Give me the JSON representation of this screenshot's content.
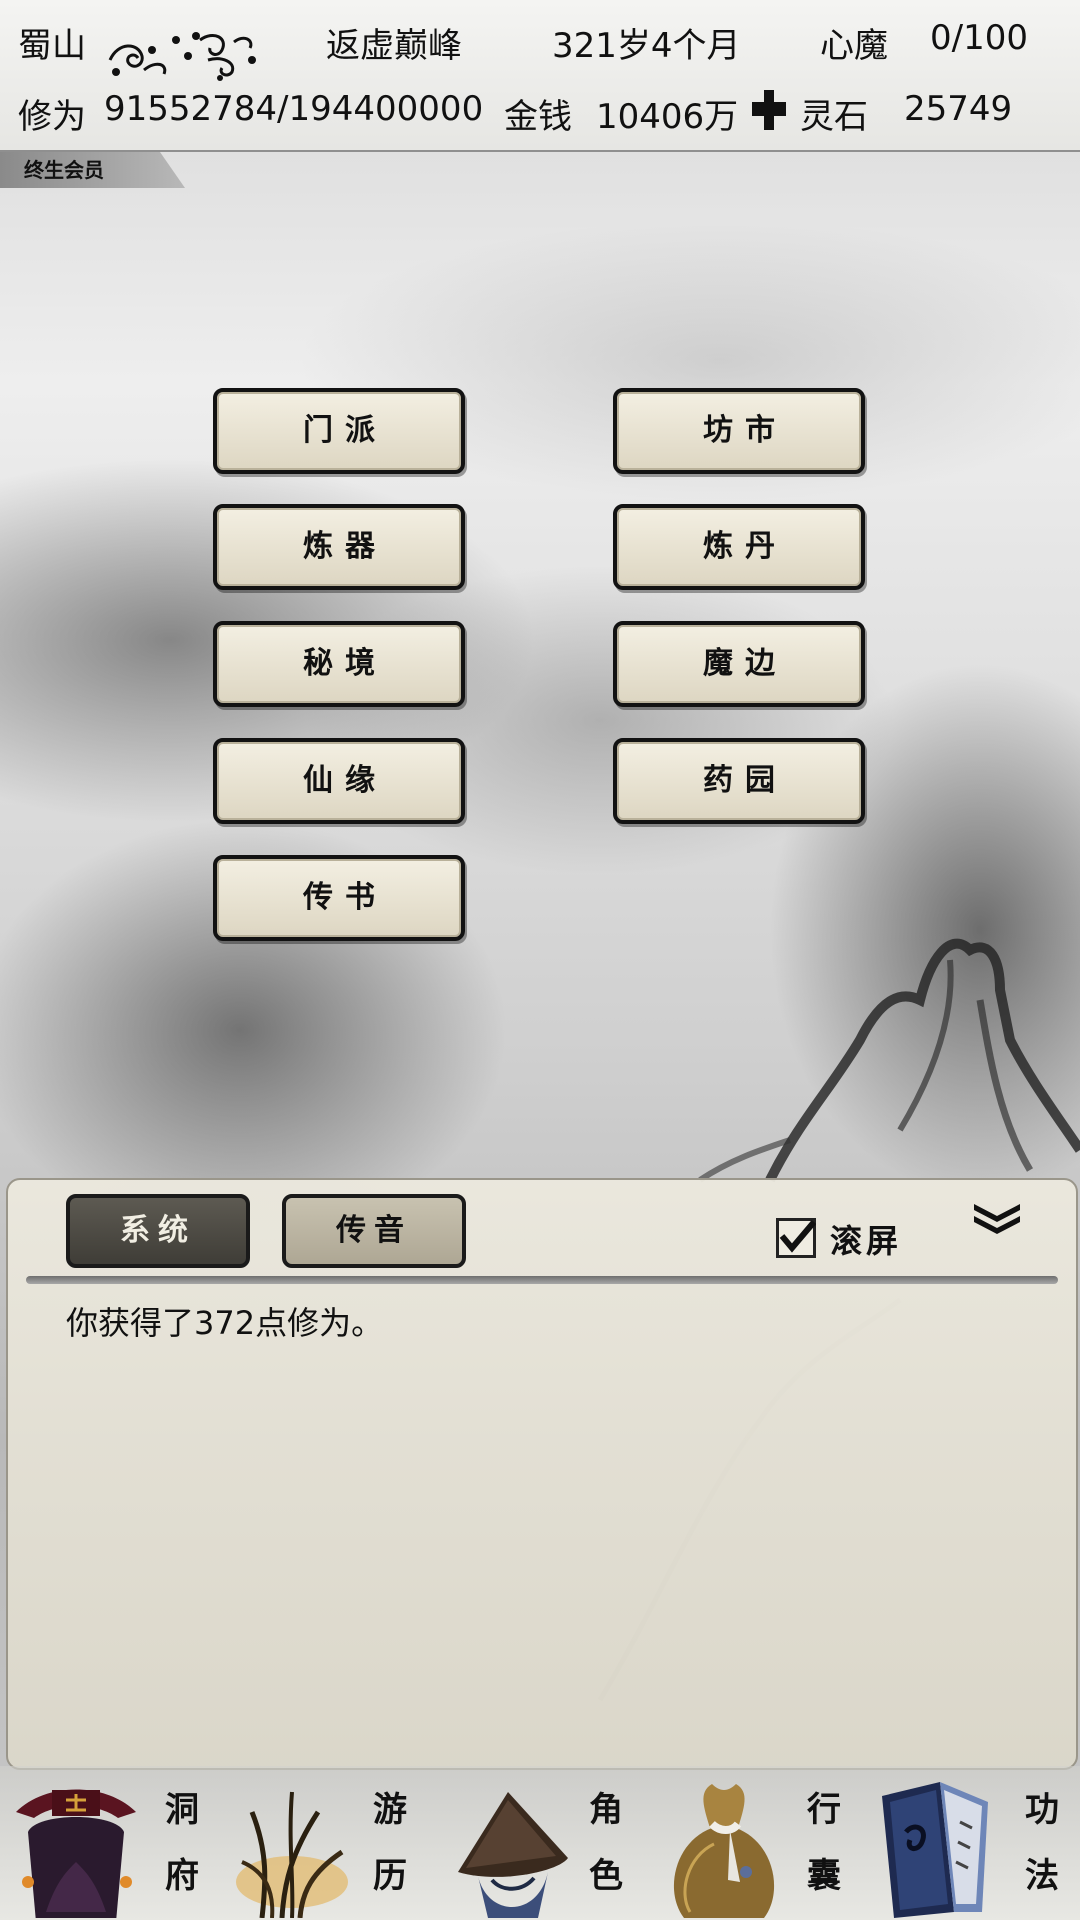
{
  "header": {
    "location": "蜀山",
    "realm": "返虚巅峰",
    "age": "321岁4个月",
    "inner_demon_label": "心魔",
    "inner_demon_value": "0/100",
    "cultivation_label": "修为",
    "cultivation_value": "91552784/194400000",
    "money_label": "金钱",
    "money_value": "10406万",
    "spirit_stone_label": "灵石",
    "spirit_stone_value": "25749"
  },
  "member_badge": "终生会员",
  "menu": {
    "sect": "门派",
    "market": "坊市",
    "forging": "炼器",
    "alchemy": "炼丹",
    "secret_realm": "秘境",
    "demon_border": "魔边",
    "immortal_fate": "仙缘",
    "herb_garden": "药园",
    "letters": "传书"
  },
  "chat": {
    "tab_system": "系统",
    "tab_voice": "传音",
    "scroll_label": "滚屏",
    "scroll_checked": true,
    "message": "你获得了372点修为。"
  },
  "nav": [
    {
      "char1": "洞",
      "char2": "府",
      "icon": "cave-lord-icon"
    },
    {
      "char1": "游",
      "char2": "历",
      "icon": "travel-grass-icon"
    },
    {
      "char1": "角",
      "char2": "色",
      "icon": "character-hat-icon"
    },
    {
      "char1": "行",
      "char2": "囊",
      "icon": "bag-icon"
    },
    {
      "char1": "功",
      "char2": "法",
      "icon": "book-icon"
    }
  ]
}
